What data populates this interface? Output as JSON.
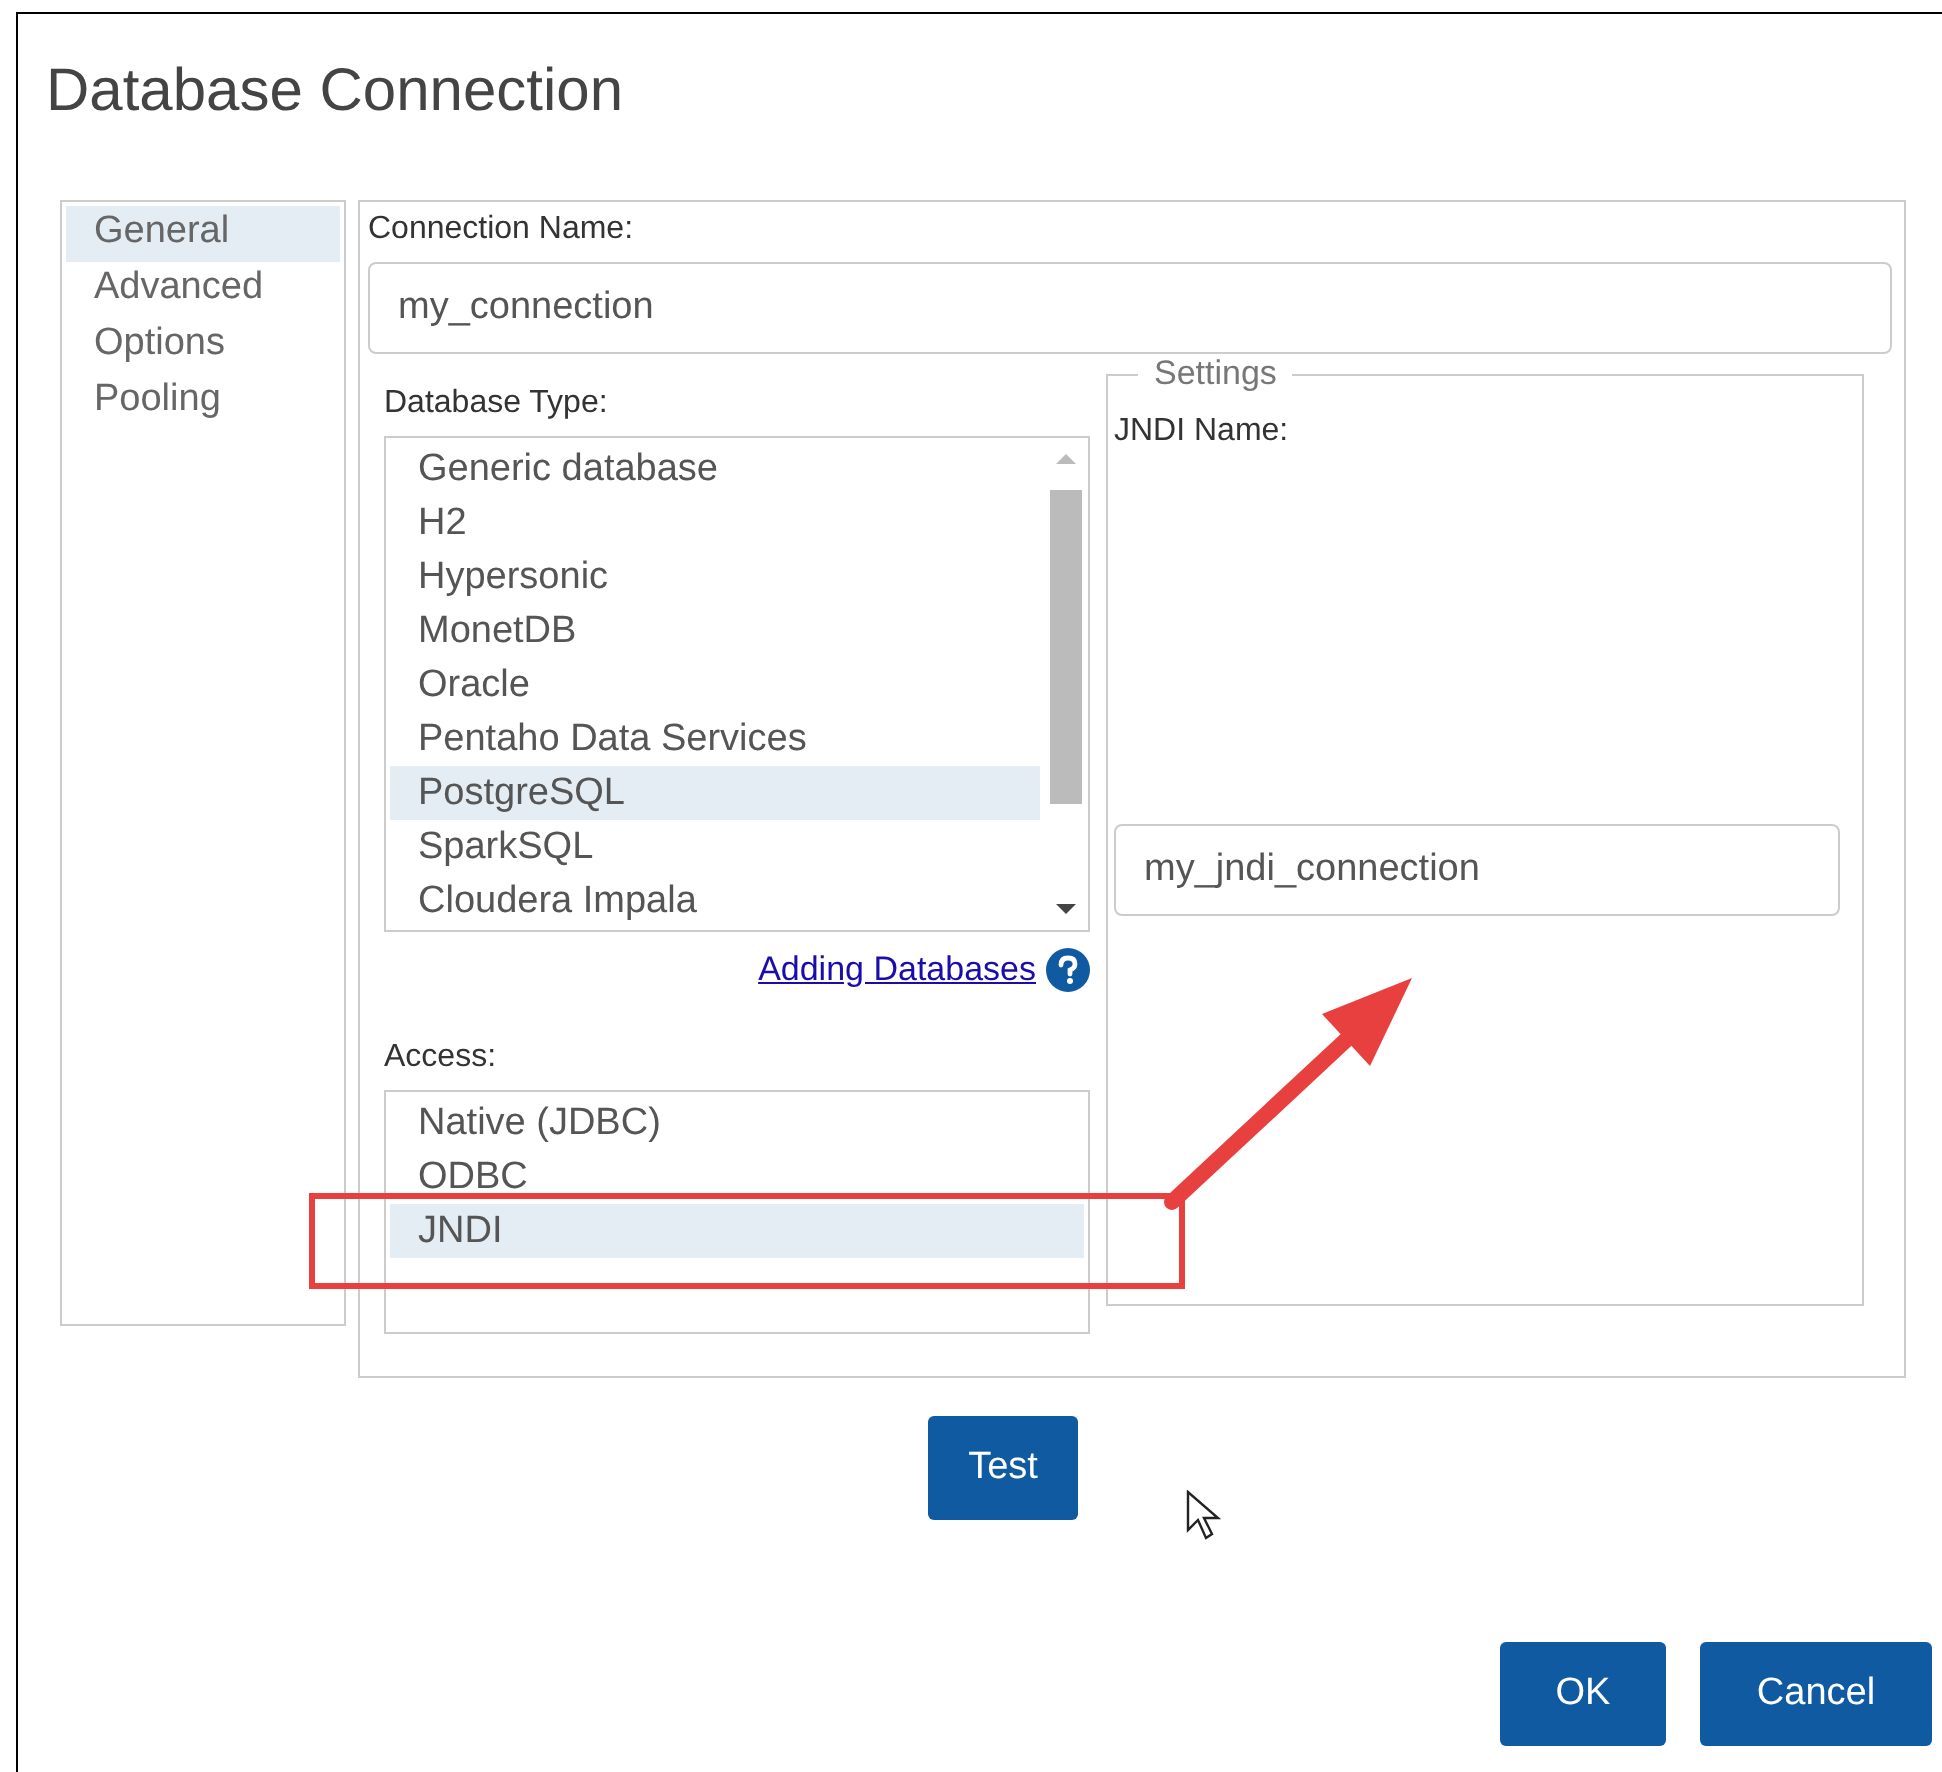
{
  "window": {
    "title": "Database Connection"
  },
  "sidebar": {
    "items": [
      {
        "label": "General",
        "selected": true
      },
      {
        "label": "Advanced",
        "selected": false
      },
      {
        "label": "Options",
        "selected": false
      },
      {
        "label": "Pooling",
        "selected": false
      }
    ]
  },
  "connection_name": {
    "label": "Connection Name:",
    "value": "my_connection"
  },
  "database_type": {
    "label": "Database Type:",
    "items": [
      {
        "label": "Generic database",
        "selected": false
      },
      {
        "label": "H2",
        "selected": false
      },
      {
        "label": "Hypersonic",
        "selected": false
      },
      {
        "label": "MonetDB",
        "selected": false
      },
      {
        "label": "Oracle",
        "selected": false
      },
      {
        "label": "Pentaho Data Services",
        "selected": false
      },
      {
        "label": "PostgreSQL",
        "selected": true
      },
      {
        "label": "SparkSQL",
        "selected": false
      },
      {
        "label": "Cloudera Impala",
        "selected": false
      }
    ]
  },
  "help_link": "Adding Databases",
  "access": {
    "label": "Access:",
    "items": [
      {
        "label": "Native (JDBC)",
        "selected": false
      },
      {
        "label": "ODBC",
        "selected": false
      },
      {
        "label": "JNDI",
        "selected": true
      }
    ]
  },
  "settings": {
    "title": "Settings",
    "jndi_label": "JNDI Name:",
    "jndi_value": "my_jndi_connection"
  },
  "buttons": {
    "test": "Test",
    "ok": "OK",
    "cancel": "Cancel"
  }
}
